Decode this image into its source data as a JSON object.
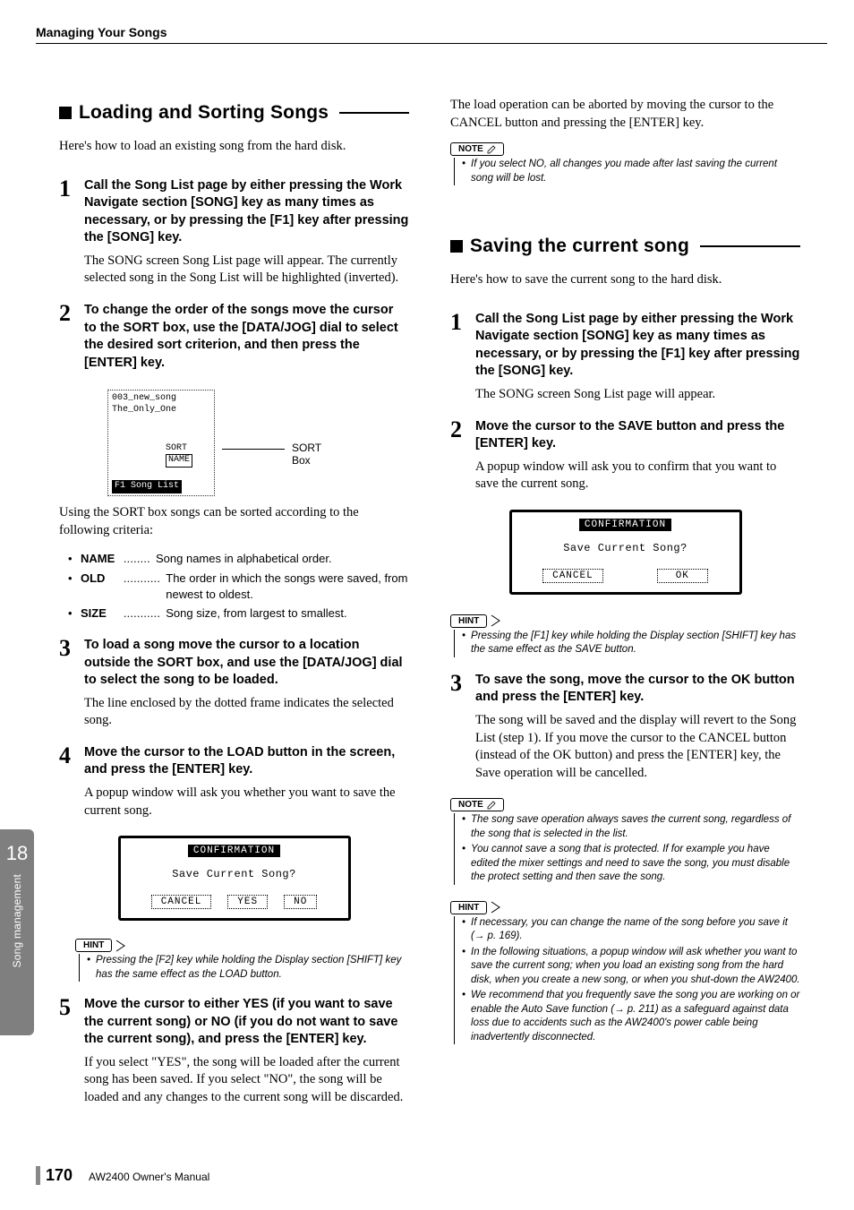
{
  "header": {
    "section_title": "Managing Your Songs"
  },
  "sidebar_tab": {
    "chapter_number": "18",
    "chapter_label": "Song management"
  },
  "footer": {
    "page_number": "170",
    "manual": "AW2400  Owner's Manual"
  },
  "left": {
    "heading": "Loading and Sorting Songs",
    "intro": "Here's how to load an existing song from the hard disk.",
    "steps": [
      {
        "num": "1",
        "head": "Call the Song List page by either pressing the Work Navigate section [SONG] key as many times as necessary, or by pressing the [F1] key after pressing the [SONG] key.",
        "text": "The SONG screen Song List page will appear. The currently selected song in the Song List will be highlighted (inverted)."
      },
      {
        "num": "2",
        "head": "To change the order of the songs move the cursor to the SORT box, use the [DATA/JOG] dial to select the desired sort criterion, and then press the [ENTER] key."
      },
      {
        "num": "3",
        "head": "To load a song move the cursor to a location outside the SORT box, and use the [DATA/JOG] dial to select the song to be loaded.",
        "text": "The line enclosed by the dotted frame indicates the selected song."
      },
      {
        "num": "4",
        "head": "Move the cursor to the LOAD button in the screen, and press the [ENTER] key.",
        "text": "A popup window will ask you whether you want to save the current song."
      },
      {
        "num": "5",
        "head": "Move the cursor to either YES (if you want to save the current song) or NO (if you do not want to save the current song), and press the [ENTER] key.",
        "text": "If you select \"YES\", the song will be loaded after the current song has been saved. If you select \"NO\", the song will be loaded and any changes to the current song will be discarded."
      }
    ],
    "sort_diagram": {
      "line1": "003_new_song",
      "line2": "The_Only_One",
      "sort_label_left": "SORT",
      "sort_value": "NAME",
      "tab_f1": "F1",
      "tab_label": "Song List",
      "sort_box_label": "SORT Box"
    },
    "sort_text": "Using the SORT box songs can be sorted according to the following criteria:",
    "criteria": [
      {
        "name": "NAME",
        "dots": "........",
        "desc": "Song names in alphabetical order."
      },
      {
        "name": "OLD",
        "dots": "...........",
        "desc": "The order in which the songs were saved, from newest to oldest."
      },
      {
        "name": "SIZE",
        "dots": "...........",
        "desc": "Song size, from largest to smallest."
      }
    ],
    "confirm_dialog": {
      "title": "CONFIRMATION",
      "message": "Save Current Song?",
      "buttons": [
        "CANCEL",
        "YES",
        "NO"
      ]
    },
    "hint": {
      "tag": "HINT",
      "items": [
        "Pressing the [F2] key while holding the Display section [SHIFT] key has the same effect as the LOAD button."
      ]
    }
  },
  "right": {
    "abort_text": "The load operation can be aborted by moving the cursor to the CANCEL button and pressing the [ENTER] key.",
    "note1": {
      "tag": "NOTE",
      "items": [
        "If you select NO, all changes you made after last saving the current song will be lost."
      ]
    },
    "heading": "Saving the current song",
    "intro": "Here's how to save the current song to the hard disk.",
    "steps": [
      {
        "num": "1",
        "head": "Call the Song List page by either pressing the Work Navigate section [SONG] key as many times as necessary, or by pressing the [F1] key after pressing the [SONG] key.",
        "text": "The SONG screen Song List page will appear."
      },
      {
        "num": "2",
        "head": "Move the cursor to the SAVE button and press the [ENTER] key.",
        "text": "A popup window will ask you to confirm that you want to save the current song."
      },
      {
        "num": "3",
        "head": "To save the song, move the cursor to the OK button and press the [ENTER] key.",
        "text": "The song will be saved and the display will revert to the Song List (step 1). If you move the cursor to the CANCEL button (instead of the OK button) and press the [ENTER] key, the Save operation will be cancelled."
      }
    ],
    "confirm_dialog": {
      "title": "CONFIRMATION",
      "message": "Save Current Song?",
      "buttons": [
        "CANCEL",
        "OK"
      ]
    },
    "hint1": {
      "tag": "HINT",
      "items": [
        "Pressing the [F1] key while holding the Display section [SHIFT] key has the same effect as the SAVE button."
      ]
    },
    "note2": {
      "tag": "NOTE",
      "items": [
        "The song save operation always saves the current song, regardless of the song that is selected in the list.",
        "You cannot save a song that is protected. If for example you have edited the mixer settings and need to save the song, you must disable the protect setting and then save the song."
      ]
    },
    "hint2": {
      "tag": "HINT",
      "items": [
        "If necessary, you can change the name of the song before you save it (→ p. 169).",
        "In the following situations, a popup window will ask whether you want to save the current song; when you load an existing song from the hard disk, when you create a new song, or when you shut-down the AW2400.",
        "We recommend that you frequently save the song you are working on or enable the Auto Save function (→ p. 211) as a safeguard against data loss due to accidents such as the AW2400's power cable being inadvertently disconnected."
      ]
    }
  }
}
